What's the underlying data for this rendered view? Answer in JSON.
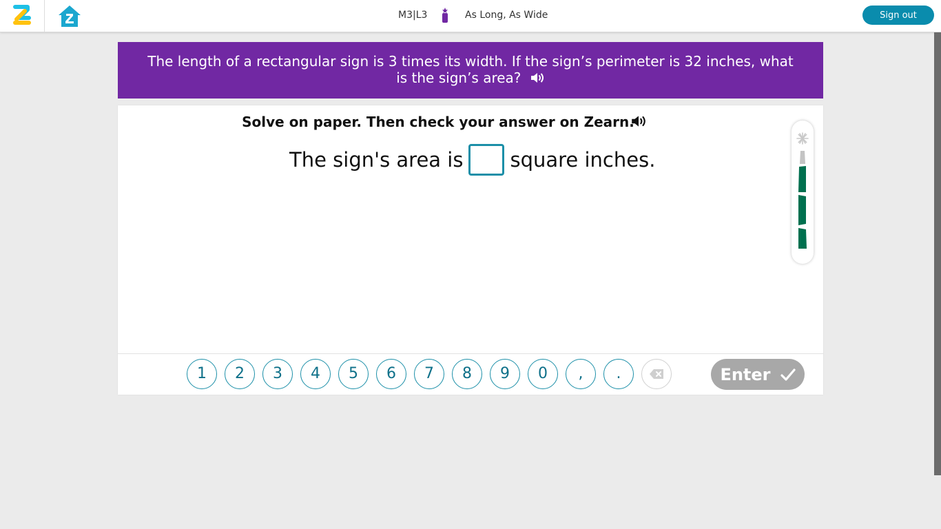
{
  "header": {
    "lesson_code": "M3|L3",
    "lesson_title": "As Long, As Wide",
    "sign_out_label": "Sign out"
  },
  "question": {
    "text": "The length of a rectangular sign is 3 times its width. If the sign’s perimeter is 32 inches, what is the sign’s area?"
  },
  "panel": {
    "instruction": "Solve on paper. Then check your answer on Zearn.",
    "sentence_before": "The sign's area is",
    "answer_value": "",
    "sentence_after": "square inches."
  },
  "keypad": {
    "keys": [
      "1",
      "2",
      "3",
      "4",
      "5",
      "6",
      "7",
      "8",
      "9",
      "0",
      ",",
      "."
    ],
    "enter_label": "Enter"
  },
  "progress": {
    "filled_segments": 3,
    "total_segments": 4
  },
  "colors": {
    "banner": "#7128a3",
    "accent": "#1b8fa8",
    "sign_out": "#0a8cad",
    "meter_fill": "#00704f",
    "enter_disabled": "#a8a8a8"
  },
  "icons": {
    "logo": "zearn-logo",
    "home": "home-icon",
    "lesson": "lesson-icon",
    "speaker": "speaker-icon",
    "backspace": "backspace-icon",
    "check": "check-icon"
  }
}
